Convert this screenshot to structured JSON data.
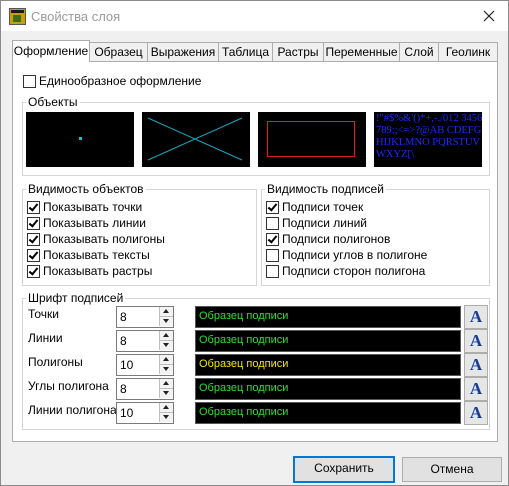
{
  "window": {
    "title": "Свойства слоя"
  },
  "tabs": [
    "Оформление",
    "Образец",
    "Выражения",
    "Таблица",
    "Растры",
    "Переменные",
    "Слой",
    "Геолинк"
  ],
  "uniform": {
    "label": "Единообразное оформление",
    "checked": false
  },
  "objects": {
    "legend": "Объекты",
    "text_sample": "!\"#$%&'()*+,-./012 3456789:;<=>?@AB CDEFGHIJKLMNO PQRSTUVWXYZ[\\"
  },
  "visibility": {
    "legend": "Видимость объектов",
    "items": [
      {
        "label": "Показывать точки",
        "checked": true
      },
      {
        "label": "Показывать линии",
        "checked": true
      },
      {
        "label": "Показывать полигоны",
        "checked": true
      },
      {
        "label": "Показывать тексты",
        "checked": true
      },
      {
        "label": "Показывать растры",
        "checked": true
      }
    ]
  },
  "labels_visibility": {
    "legend": "Видимость подписей",
    "items": [
      {
        "label": "Подписи точек",
        "checked": true
      },
      {
        "label": "Подписи линий",
        "checked": false
      },
      {
        "label": "Подписи полигонов",
        "checked": true
      },
      {
        "label": "Подписи углов в полигоне",
        "checked": false
      },
      {
        "label": "Подписи сторон полигона",
        "checked": false
      }
    ]
  },
  "font": {
    "legend": "Шрифт подписей",
    "rows": [
      {
        "label": "Точки",
        "size": "8",
        "sample": "Образец подписи",
        "color": "#33dd33"
      },
      {
        "label": "Линии",
        "size": "8",
        "sample": "Образец подписи",
        "color": "#33dd33"
      },
      {
        "label": "Полигоны",
        "size": "10",
        "sample": "Образец подписи",
        "color": "#f2e600"
      },
      {
        "label": "Углы полигона",
        "size": "8",
        "sample": "Образец подписи",
        "color": "#33dd33"
      },
      {
        "label": "Линии полигона",
        "size": "10",
        "sample": "Образец подписи",
        "color": "#33dd33"
      }
    ],
    "button_glyph": "A"
  },
  "buttons": {
    "save": "Сохранить",
    "cancel": "Отмена"
  },
  "colors": {
    "accent": "#0078d7",
    "point": "#00c8c8",
    "polygon": "#e02020",
    "text_sample": "#1a2cff"
  }
}
